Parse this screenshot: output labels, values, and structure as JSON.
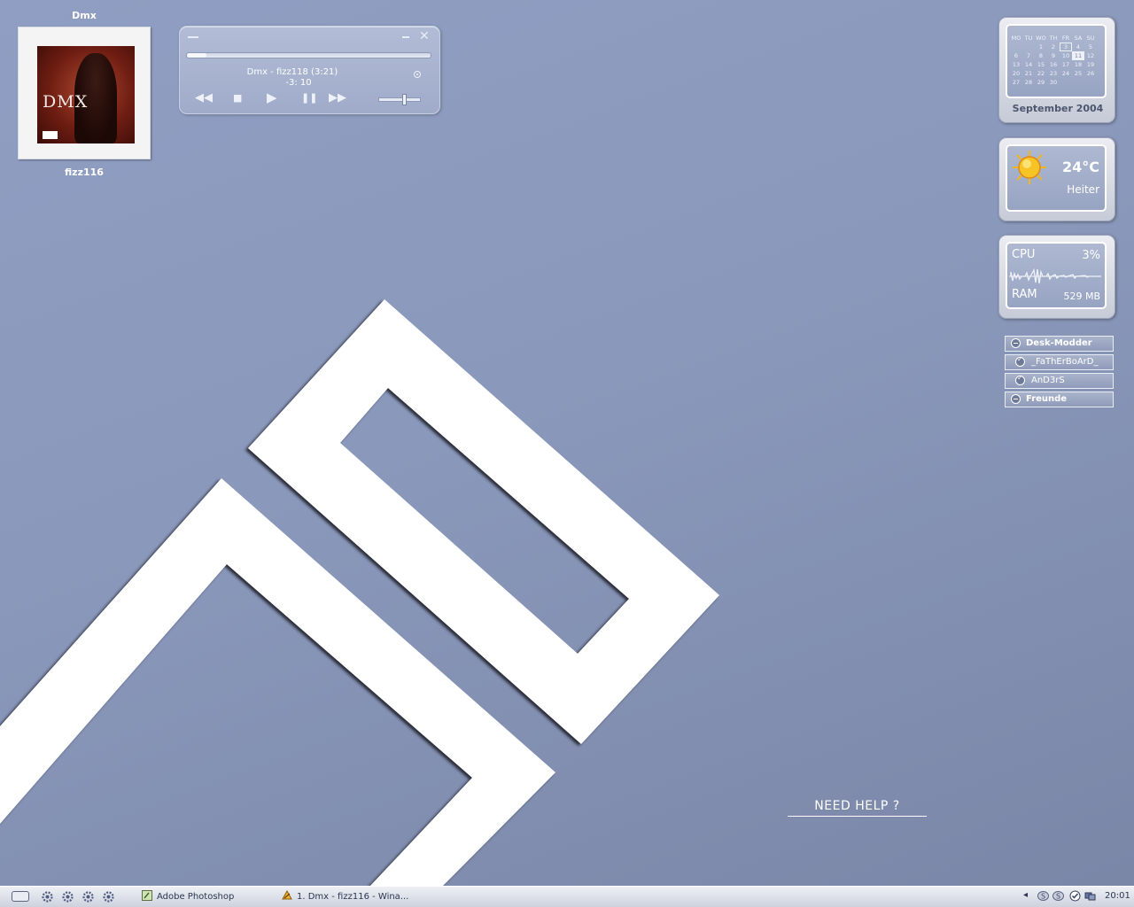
{
  "now_playing": {
    "artist": "Dmx",
    "track": "fizz116",
    "cover": {
      "text": "DMX",
      "advisory_text": "PARENTAL ADVISORY"
    }
  },
  "player": {
    "title": "Dmx - fizz118 (3:21)",
    "time": "-3: 10",
    "progress": 0.08,
    "volume": 0.6,
    "close_label": "✕",
    "buttons": {
      "prev": "◀◀",
      "stop": "■",
      "play": "▶",
      "pause": "❚❚",
      "next": "▶▶"
    }
  },
  "calendar": {
    "days": [
      "MO",
      "TU",
      "WO",
      "TH",
      "FR",
      "SA",
      "SU"
    ],
    "weeks": [
      [
        "",
        "",
        "1",
        "2",
        "3",
        "4",
        "5"
      ],
      [
        "6",
        "7",
        "8",
        "9",
        "10",
        "11",
        "12"
      ],
      [
        "13",
        "14",
        "15",
        "16",
        "17",
        "18",
        "19"
      ],
      [
        "20",
        "21",
        "22",
        "23",
        "24",
        "25",
        "26"
      ],
      [
        "27",
        "28",
        "29",
        "30",
        "",
        "",
        ""
      ]
    ],
    "today": "3",
    "selected": "11",
    "month_label": "September 2004"
  },
  "weather": {
    "temp": "24°C",
    "condition": "Heiter",
    "icon": "sun-icon"
  },
  "system": {
    "cpu_label": "CPU",
    "cpu_value": "3%",
    "ram_label": "RAM",
    "ram_value": "529 MB"
  },
  "contacts": [
    {
      "type": "group",
      "label": "Desk-Modder"
    },
    {
      "type": "user",
      "label": "_FaThErBoArD_"
    },
    {
      "type": "user",
      "label": "AnD3rS"
    },
    {
      "type": "group",
      "label": "Freunde"
    }
  ],
  "help_label": "NEED HELP ?",
  "taskbar": {
    "tasks": [
      {
        "label": "Adobe Photoshop",
        "icon": "photoshop-icon"
      },
      {
        "label": "1. Dmx - fizz116 - Wina...",
        "icon": "winamp-icon"
      }
    ],
    "tray_arrow": "◂",
    "clock": "20:01"
  },
  "colors": {
    "background": "#8f9ec2",
    "accent_white": "#ffffff",
    "taskbar": "#dde1ea"
  }
}
